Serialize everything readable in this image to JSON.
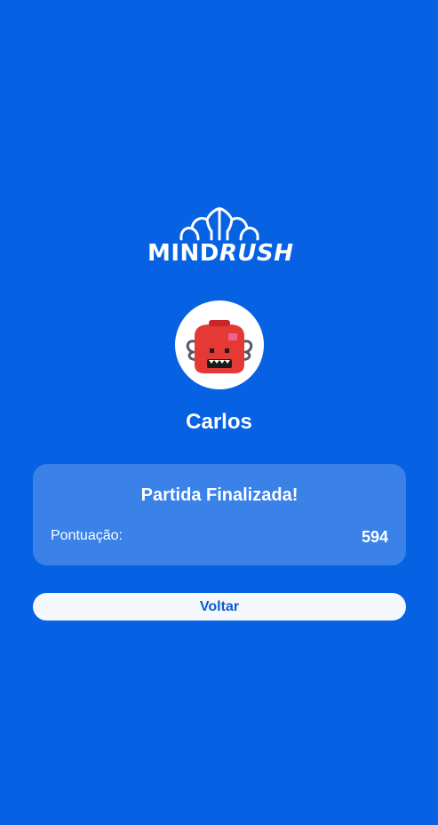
{
  "logo": {
    "text_plain": "MIND",
    "text_italic": "RUSH",
    "icon": "brain-icon"
  },
  "player": {
    "name": "Carlos",
    "avatar_icon": "red-monster-avatar-icon"
  },
  "result": {
    "title": "Partida Finalizada!",
    "score_label": "Pontuação:",
    "score_value": "594"
  },
  "actions": {
    "back_label": "Voltar"
  },
  "colors": {
    "background": "#0762e3",
    "card": "#3a82e8",
    "button_bg": "#f4f8fc",
    "button_text": "#0d5bcf",
    "avatar_red": "#e53935"
  }
}
